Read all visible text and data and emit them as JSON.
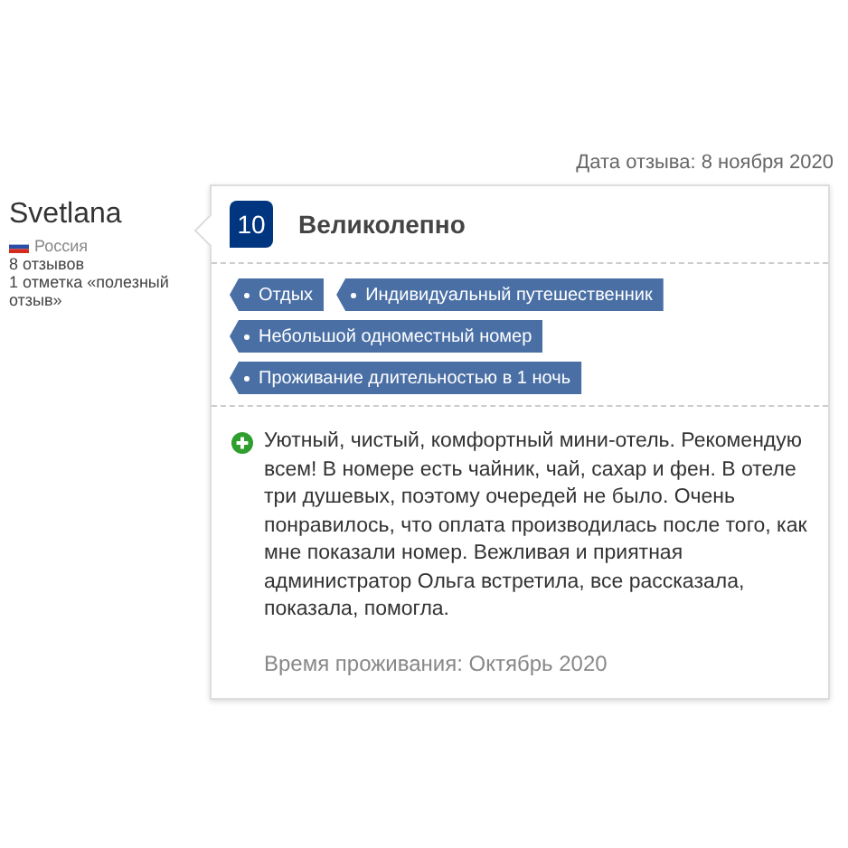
{
  "review_date": "Дата отзыва: 8 ноября 2020",
  "reviewer": {
    "name": "Svetlana",
    "country": "Россия",
    "reviews_count": "8 отзывов",
    "helpful_votes": "1 отметка «полезный отзыв»"
  },
  "rating": {
    "score": "10",
    "label": "Великолепно"
  },
  "tag_rows": [
    [
      "Отдых",
      "Индивидуальный путешественник"
    ],
    [
      "Небольшой одноместный номер"
    ],
    [
      "Проживание длительностью в 1 ночь"
    ]
  ],
  "positive_text": "Уютный, чистый, комфортный мини-отель. Рекомендую всем! В номере есть чайник, чай, сахар и фен. В отеле три душевых, поэтому очередей не было. Очень понравилось, что оплата производилась после того, как мне показали номер. Вежливая и приятная администратор Ольга встретила, все рассказала, показала, помогла.",
  "stay_date": "Время проживания: Октябрь 2020"
}
